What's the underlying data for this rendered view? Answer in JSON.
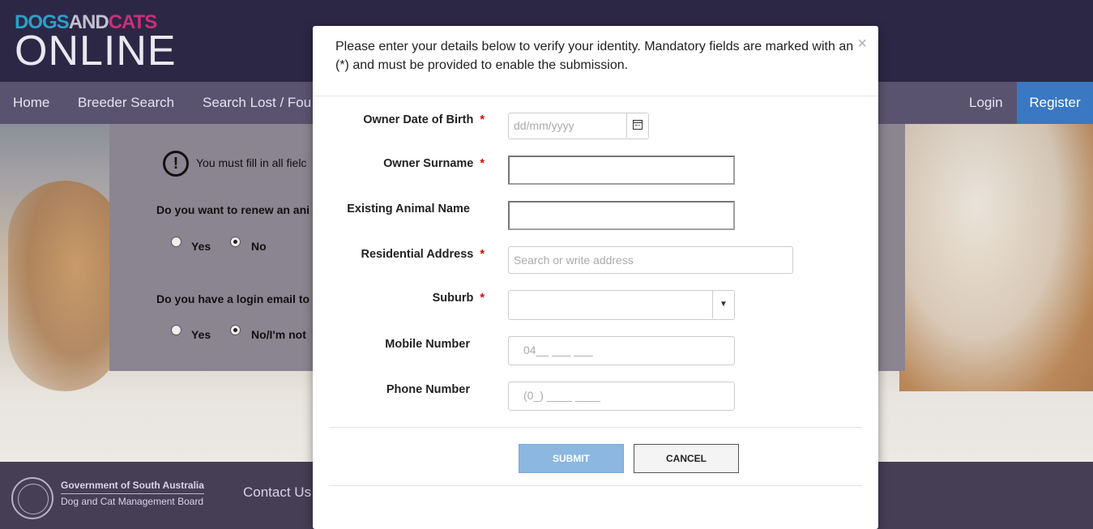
{
  "logo": {
    "dogs": "DOGS",
    "and": "AND",
    "cats": "CATS",
    "online": "ONLINE"
  },
  "nav": {
    "items": [
      "Home",
      "Breeder Search",
      "Search Lost / Fou"
    ],
    "login": "Login",
    "register": "Register"
  },
  "background_form": {
    "warning_icon_char": "!",
    "warning": "You must fill in all fielc",
    "question1": "Do you want to renew an ani",
    "q1_yes": "Yes",
    "q1_no": "No",
    "question2": "Do you have a login email to",
    "q2_yes": "Yes",
    "q2_no": "No/I'm not"
  },
  "footer": {
    "gov_title": "Government of South Australia",
    "gov_sub": "Dog and Cat Management Board",
    "contact": "Contact Us"
  },
  "modal": {
    "intro": "Please enter your details below to verify your identity. Mandatory fields are marked with an (*) and must be provided to enable the submission.",
    "close": "×",
    "required_marker": "*",
    "fields": {
      "dob": {
        "label": "Owner Date of Birth",
        "placeholder": "dd/mm/yyyy"
      },
      "surname": {
        "label": "Owner Surname",
        "value": ""
      },
      "animal": {
        "label": "Existing Animal Name",
        "value": ""
      },
      "address": {
        "label": "Residential Address",
        "placeholder": "Search or write address"
      },
      "suburb": {
        "label": "Suburb",
        "value": "",
        "arrow": "▼"
      },
      "mobile": {
        "label": "Mobile Number",
        "placeholder": "04__ ___ ___"
      },
      "phone": {
        "label": "Phone Number",
        "placeholder": "(0_) ____ ____"
      }
    },
    "submit": "SUBMIT",
    "cancel": "CANCEL"
  }
}
